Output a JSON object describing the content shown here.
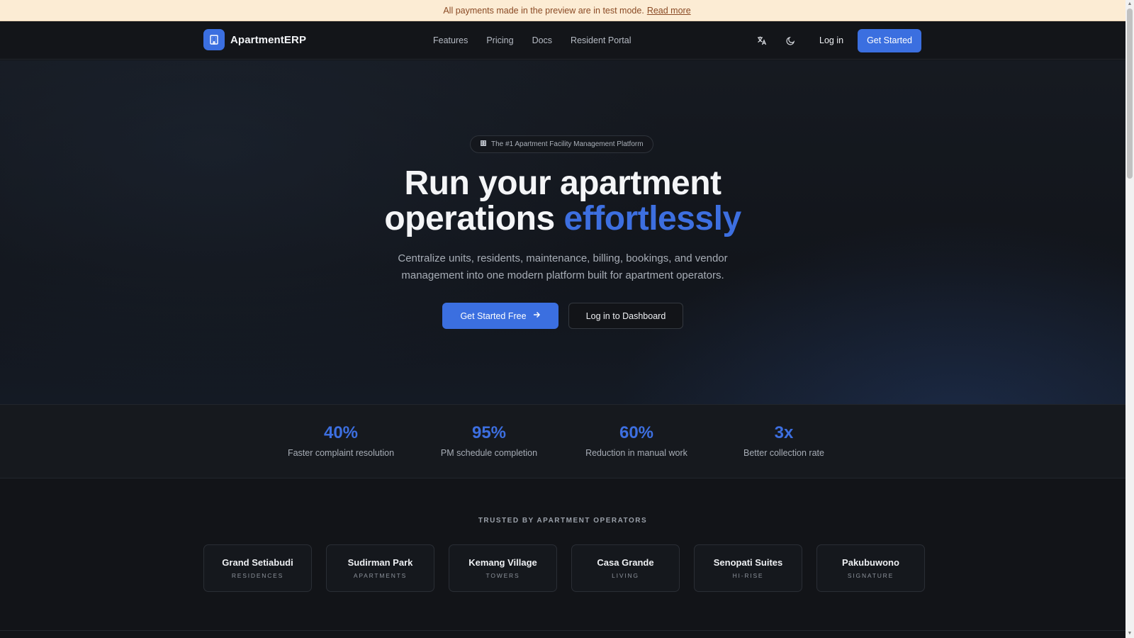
{
  "banner": {
    "text": "All payments made in the preview are in test mode.",
    "link": "Read more"
  },
  "nav": {
    "brand": "ApartmentERP",
    "links": [
      "Features",
      "Pricing",
      "Docs",
      "Resident Portal"
    ],
    "login": "Log in",
    "cta": "Get Started",
    "icons": [
      "translate-icon",
      "moon-icon"
    ]
  },
  "hero": {
    "badge": "The #1 Apartment Facility Management Platform",
    "title_line1": "Run your apartment",
    "title_line2_plain": "operations",
    "title_line2_accent": "effortlessly",
    "subtitle": "Centralize units, residents, maintenance, billing, bookings, and vendor management into one modern platform built for apartment operators.",
    "primary_cta": "Get Started Free",
    "secondary_cta": "Log in to Dashboard"
  },
  "stats": [
    {
      "value": "40%",
      "label": "Faster complaint resolution"
    },
    {
      "value": "95%",
      "label": "PM schedule completion"
    },
    {
      "value": "60%",
      "label": "Reduction in manual work"
    },
    {
      "value": "3x",
      "label": "Better collection rate"
    }
  ],
  "trusted": {
    "title": "TRUSTED BY APARTMENT OPERATORS",
    "logos": [
      {
        "name": "Grand Setiabudi",
        "sub": "RESIDENCES"
      },
      {
        "name": "Sudirman Park",
        "sub": "APARTMENTS"
      },
      {
        "name": "Kemang Village",
        "sub": "TOWERS"
      },
      {
        "name": "Casa Grande",
        "sub": "LIVING"
      },
      {
        "name": "Senopati Suites",
        "sub": "HI-RISE"
      },
      {
        "name": "Pakubuwono",
        "sub": "SIGNATURE"
      }
    ]
  },
  "colors": {
    "accent": "#3b6fe0",
    "banner_bg": "#fcecd4",
    "page_bg": "#121418"
  }
}
